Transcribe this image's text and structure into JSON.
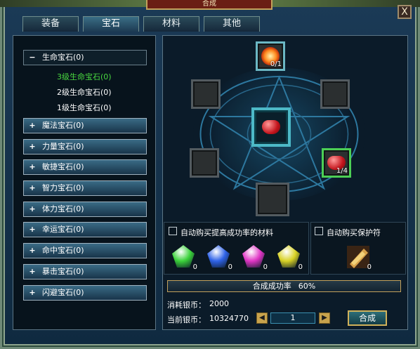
{
  "window": {
    "title": "合成",
    "close_label": "X"
  },
  "tabs": [
    {
      "label": "装备",
      "active": false
    },
    {
      "label": "宝石",
      "active": true
    },
    {
      "label": "材料",
      "active": false
    },
    {
      "label": "其他",
      "active": false
    }
  ],
  "sidebar": {
    "groups": [
      {
        "label": "生命宝石(0)",
        "expanded": true,
        "children": [
          {
            "label": "3级生命宝石(0)",
            "active": true
          },
          {
            "label": "2级生命宝石(0)",
            "active": false
          },
          {
            "label": "1级生命宝石(0)",
            "active": false
          }
        ]
      },
      {
        "label": "魔法宝石(0)",
        "expanded": false
      },
      {
        "label": "力量宝石(0)",
        "expanded": false
      },
      {
        "label": "敏捷宝石(0)",
        "expanded": false
      },
      {
        "label": "智力宝石(0)",
        "expanded": false
      },
      {
        "label": "体力宝石(0)",
        "expanded": false
      },
      {
        "label": "幸运宝石(0)",
        "expanded": false
      },
      {
        "label": "命中宝石(0)",
        "expanded": false
      },
      {
        "label": "暴击宝石(0)",
        "expanded": false
      },
      {
        "label": "闪避宝石(0)",
        "expanded": false
      }
    ],
    "expand_icon": "plus-icon",
    "collapse_icon": "minus-icon"
  },
  "synthesis": {
    "top_slot_count": "0/1",
    "right_slot_count": "1/4",
    "center_item_icon": "red-gem-icon",
    "top_item_icon": "fire-rune-icon"
  },
  "auto_buy": {
    "materials_label": "自动购买提高成功率的材料",
    "protect_label": "自动购买保护符",
    "materials_checked": false,
    "protect_checked": false
  },
  "materials": [
    {
      "icon": "green-crystal-icon",
      "count": "0",
      "color": "#3bd23a"
    },
    {
      "icon": "blue-crystal-icon",
      "count": "0",
      "color": "#2f63e8"
    },
    {
      "icon": "purple-crystal-icon",
      "count": "0",
      "color": "#e035c5"
    },
    {
      "icon": "yellow-crystal-icon",
      "count": "0",
      "color": "#d8d225"
    }
  ],
  "protect_item": {
    "icon": "scroll-icon",
    "count": "0"
  },
  "rate": {
    "label": "合成成功率",
    "value": "60%"
  },
  "costs": {
    "consume_label": "消耗银币：",
    "consume_value": "2000",
    "current_label": "当前银币：",
    "current_value": "10324770"
  },
  "quantity": {
    "value": "1"
  },
  "combine_button": "合成"
}
